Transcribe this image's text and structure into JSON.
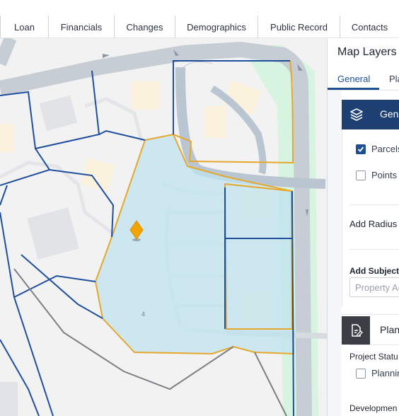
{
  "tabs": [
    {
      "label": "Loan"
    },
    {
      "label": "Financials"
    },
    {
      "label": "Changes"
    },
    {
      "label": "Demographics"
    },
    {
      "label": "Public Record"
    },
    {
      "label": "Contacts"
    }
  ],
  "map": {
    "parcel_number": "4",
    "colors": {
      "parcel_outline": "#1f4e9c",
      "subject_outline": "#e8a92a",
      "subject_fill": "#bfe3ef",
      "road": "#c5ccd4",
      "greenway": "#d5f3df",
      "marker": "#f0a500"
    }
  },
  "panel": {
    "title": "Map Layers",
    "tabs": [
      {
        "label": "General",
        "active": true
      },
      {
        "label": "Pla",
        "active": false
      }
    ],
    "general_section": {
      "title": "Gen",
      "icon": "layers-icon",
      "options": [
        {
          "label": "Parcels",
          "checked": true
        },
        {
          "label": "Points o",
          "checked": false
        }
      ],
      "add_radius_label": "Add Radius",
      "add_subject_label": "Add Subject",
      "property_placeholder": "Property Ac"
    },
    "planning_section": {
      "title": "Plan",
      "icon": "edit-document-icon",
      "project_status_label": "Project Statu",
      "planning_option": "Plannin",
      "development_label": "Developmen"
    },
    "accent": "#1d4f91"
  }
}
